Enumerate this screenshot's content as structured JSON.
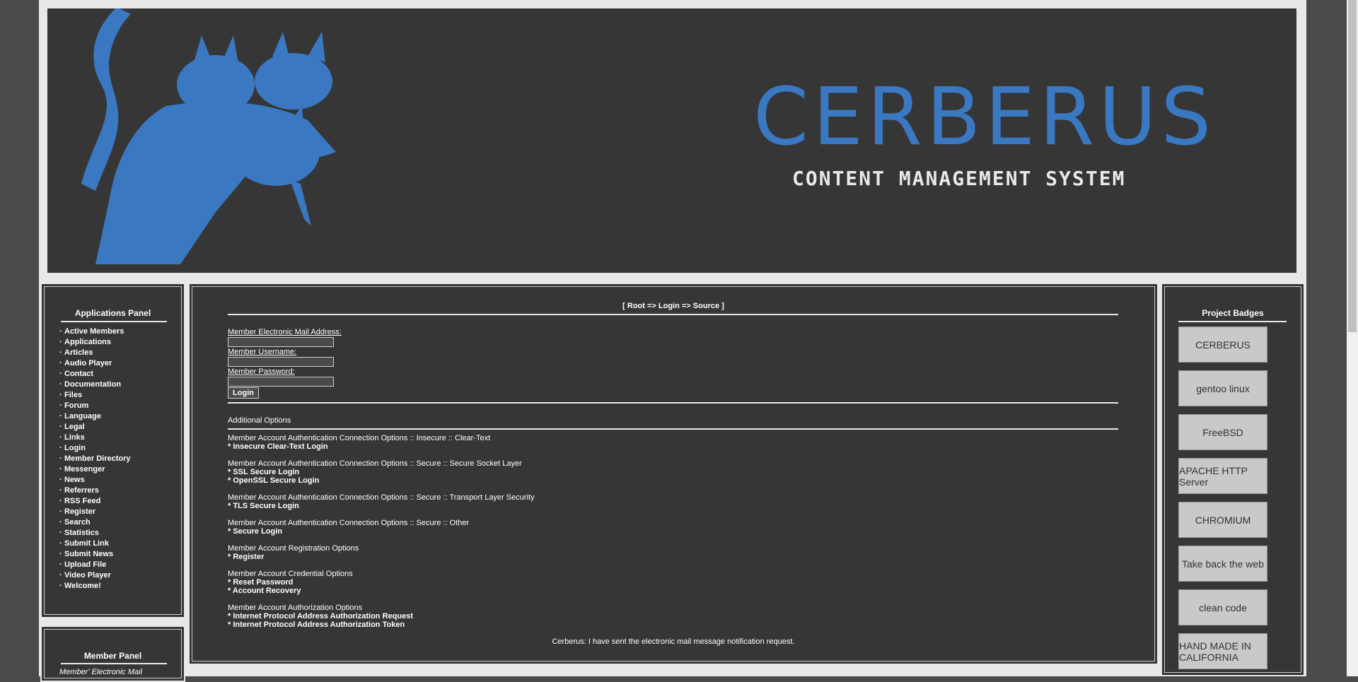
{
  "banner": {
    "title": "CERBERUS",
    "subtitle": "CONTENT MANAGEMENT SYSTEM"
  },
  "applications_panel": {
    "title": "Applications Panel",
    "items": [
      "Active Members",
      "Applications",
      "Articles",
      "Audio Player",
      "Contact",
      "Documentation",
      "Files",
      "Forum",
      "Language",
      "Legal",
      "Links",
      "Login",
      "Member Directory",
      "Messenger",
      "News",
      "Referrers",
      "RSS Feed",
      "Register",
      "Search",
      "Statistics",
      "Submit Link",
      "Submit News",
      "Upload File",
      "Video Player",
      "Welcome!"
    ]
  },
  "member_panel": {
    "title": "Member Panel",
    "label": "Member' Electronic Mail"
  },
  "main": {
    "breadcrumb": "[ Root => Login => Source ]",
    "email_label": "Member Electronic Mail Address:",
    "username_label": "Member Username:",
    "password_label": "Member Password:",
    "login_button": "Login",
    "additional_options": "Additional Options",
    "sections": [
      {
        "heading": "Member Account Authentication Connection Options :: Insecure :: Clear-Text",
        "links": [
          "* Insecure Clear-Text Login"
        ]
      },
      {
        "heading": "Member Account Authentication Connection Options :: Secure :: Secure Socket Layer",
        "links": [
          "* SSL Secure Login",
          "* OpenSSL Secure Login"
        ]
      },
      {
        "heading": "Member Account Authentication Connection Options :: Secure :: Transport Layer Security",
        "links": [
          "* TLS Secure Login"
        ]
      },
      {
        "heading": "Member Account Authentication Connection Options :: Secure :: Other",
        "links": [
          "* Secure Login"
        ]
      },
      {
        "heading": "Member Account Registration Options",
        "links": [
          "* Register"
        ]
      },
      {
        "heading": "Member Account Credential Options",
        "links": [
          "* Reset Password",
          "* Account Recovery"
        ]
      },
      {
        "heading": "Member Account Authorization Options",
        "links": [
          "* Internet Protocol Address Authorization Request",
          "* Internet Protocol Address Authorization Token"
        ]
      }
    ],
    "status_message": "Cerberus: I have sent the electronic mail message notification request."
  },
  "badges_panel": {
    "title": "Project Badges",
    "badges": [
      {
        "name": "cerberus-badge",
        "text": "CERBERUS"
      },
      {
        "name": "gentoo-badge",
        "text": "gentoo linux"
      },
      {
        "name": "freebsd-badge",
        "text": "FreeBSD"
      },
      {
        "name": "apache-badge",
        "text": "APACHE HTTP Server"
      },
      {
        "name": "chromium-badge",
        "text": "CHROMIUM"
      },
      {
        "name": "firefox-badge",
        "text": "Take back the web"
      },
      {
        "name": "cleancode-badge",
        "text": "clean code"
      },
      {
        "name": "handmade-badge",
        "text": "HAND MADE IN CALIFORNIA"
      }
    ]
  },
  "colors": {
    "accent": "#3a78c2",
    "panel_bg": "#363636",
    "page_border": "#e8e8e8",
    "outer_bg": "#4a4a4a"
  }
}
